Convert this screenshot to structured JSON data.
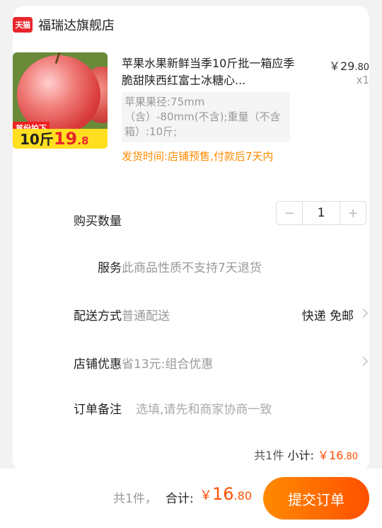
{
  "store": {
    "badge": "天猫",
    "name": "福瑞达旗舰店"
  },
  "product": {
    "promo_tag": "首份拍下",
    "promo_weight": "10斤",
    "promo_price_int": "19",
    "promo_price_dec": ".8",
    "title": "苹果水果新鲜当季10斤批一箱应季脆甜陕西红富士冰糖心...",
    "price_int": "￥29",
    "price_dec": ".80",
    "quantity_x": "x1",
    "sku": "苹果果径:75mm（含）-80mm(不含);重量（不含箱）:10斤;",
    "ship_note": "发货时间:店铺预售,付款后7天内"
  },
  "rows": {
    "quantity": {
      "label": "购买数量",
      "minus": "−",
      "value": "1",
      "plus": "+"
    },
    "service": {
      "label": "服务",
      "value": "此商品性质不支持7天退货"
    },
    "delivery": {
      "label": "配送方式",
      "value": "普通配送",
      "right": "快递 免邮"
    },
    "discount": {
      "label": "店铺优惠",
      "value": "省13元:组合优惠"
    },
    "note": {
      "label": "订单备注",
      "placeholder": "选填,请先和商家协商一致"
    }
  },
  "subtotal": {
    "count": "共1件",
    "label": " 小计: ",
    "amount_int": "￥16",
    "amount_dec": ".80"
  },
  "bottom": {
    "count": "共1件，",
    "total_label": "合计:",
    "total_currency": "￥",
    "total_int": "16",
    "total_dec": ".80",
    "submit": "提交订单"
  },
  "colors": {
    "accent": "#ff5000",
    "tmall_red": "#e8262c",
    "ship_note": "#ff8a00"
  }
}
